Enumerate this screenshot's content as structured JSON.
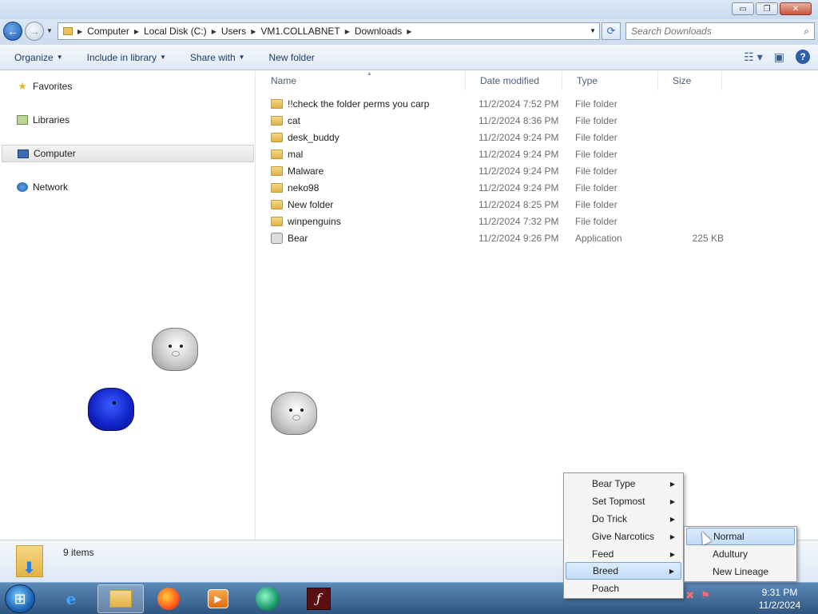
{
  "window": {
    "buttons": {
      "minimize": "▭",
      "maximize": "❐",
      "close": "✕"
    }
  },
  "address": {
    "breadcrumbs": [
      "Computer",
      "Local Disk (C:)",
      "Users",
      "VM1.COLLABNET",
      "Downloads"
    ],
    "search_placeholder": "Search Downloads"
  },
  "toolbar": {
    "organize": "Organize",
    "include_in_library": "Include in library",
    "share_with": "Share with",
    "new_folder": "New folder"
  },
  "navigation": {
    "items": [
      {
        "label": "Favorites",
        "icon": "star-icon"
      },
      {
        "label": "Libraries",
        "icon": "libraries-icon"
      },
      {
        "label": "Computer",
        "icon": "computer-icon",
        "selected": true
      },
      {
        "label": "Network",
        "icon": "network-icon"
      }
    ]
  },
  "columns": {
    "name": "Name",
    "date_modified": "Date modified",
    "type": "Type",
    "size": "Size"
  },
  "files": [
    {
      "name": "!!check the folder perms you carp",
      "date": "11/2/2024 7:52 PM",
      "type": "File folder",
      "size": "",
      "icon": "folder-icon"
    },
    {
      "name": "cat",
      "date": "11/2/2024 8:36 PM",
      "type": "File folder",
      "size": "",
      "icon": "folder-icon"
    },
    {
      "name": "desk_buddy",
      "date": "11/2/2024 9:24 PM",
      "type": "File folder",
      "size": "",
      "icon": "folder-icon"
    },
    {
      "name": "mal",
      "date": "11/2/2024 9:24 PM",
      "type": "File folder",
      "size": "",
      "icon": "folder-icon"
    },
    {
      "name": "Malware",
      "date": "11/2/2024 9:24 PM",
      "type": "File folder",
      "size": "",
      "icon": "folder-icon"
    },
    {
      "name": "neko98",
      "date": "11/2/2024 9:24 PM",
      "type": "File folder",
      "size": "",
      "icon": "folder-icon"
    },
    {
      "name": "New folder",
      "date": "11/2/2024 8:25 PM",
      "type": "File folder",
      "size": "",
      "icon": "folder-icon"
    },
    {
      "name": "winpenguins",
      "date": "11/2/2024 7:32 PM",
      "type": "File folder",
      "size": "",
      "icon": "folder-icon"
    },
    {
      "name": "Bear",
      "date": "11/2/2024 9:26 PM",
      "type": "Application",
      "size": "225 KB",
      "icon": "application-icon"
    }
  ],
  "details": {
    "item_count": "9 items"
  },
  "context_menu": {
    "items": [
      {
        "label": "Bear Type",
        "submenu": true
      },
      {
        "label": "Set Topmost",
        "submenu": true
      },
      {
        "label": "Do Trick",
        "submenu": true
      },
      {
        "label": "Give Narcotics",
        "submenu": true
      },
      {
        "label": "Feed",
        "submenu": true
      },
      {
        "label": "Breed",
        "submenu": true,
        "highlighted": true
      },
      {
        "label": "Poach",
        "submenu": false
      }
    ],
    "breed_submenu": [
      {
        "label": "Normal",
        "highlighted": true
      },
      {
        "label": "Adultury"
      },
      {
        "label": "New Lineage"
      }
    ]
  },
  "taskbar": {
    "apps": [
      {
        "name": "internet-explorer-icon"
      },
      {
        "name": "windows-explorer-icon",
        "active": true
      },
      {
        "name": "firefox-icon"
      },
      {
        "name": "media-player-icon"
      },
      {
        "name": "app-icon"
      },
      {
        "name": "flash-icon"
      }
    ],
    "clock": {
      "time": "9:31 PM",
      "date": "11/2/2024"
    }
  },
  "colors": {
    "accent": "#2b5fa8",
    "folder": "#e8c35a",
    "taskbar": "#3f6a99",
    "blue_bear": "#1023c6"
  }
}
